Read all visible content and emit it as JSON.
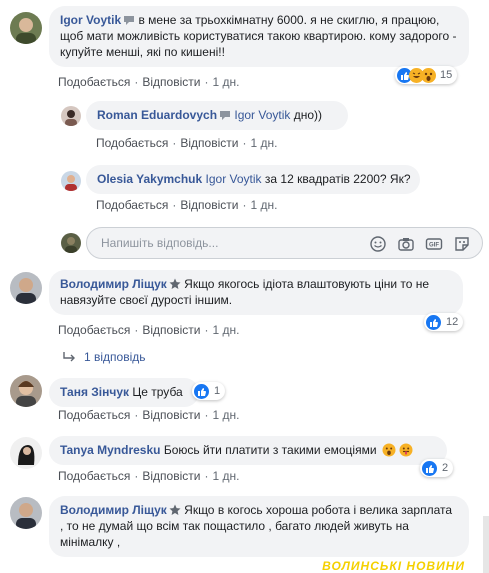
{
  "comments": [
    {
      "author": "Igor Voytik",
      "text": "в мене за трьохкімнатну 6000. я не скиглю, я працюю, щоб мати можливість користуватися такою квартирою. кому задорого - купуйте менші, які по кишені!!",
      "like": "Подобається",
      "reply": "Відповісти",
      "time": "1 дн.",
      "reaction_count": "15"
    },
    {
      "author": "Roman Eduardovych",
      "tag": "Igor Voytik",
      "text": "дно))",
      "like": "Подобається",
      "reply": "Відповісти",
      "time": "1 дн."
    },
    {
      "author": "Olesia Yakymchuk",
      "tag": "Igor Voytik",
      "text": "за 12 квадратів 2200? Як?",
      "like": "Подобається",
      "reply": "Відповісти",
      "time": "1 дн."
    },
    {
      "author": "Володимир Ліщук",
      "text": "Якщо якогось ідіота влаштовують ціни то не навязуйте своєї дурості іншим.",
      "like": "Подобається",
      "reply": "Відповісти",
      "time": "1 дн.",
      "reaction_count": "12",
      "replies_label": "1 відповідь"
    },
    {
      "author": "Таня Зінчук",
      "text": "Це труба",
      "like": "Подобається",
      "reply": "Відповісти",
      "time": "1 дн.",
      "reaction_count": "1"
    },
    {
      "author": "Tanya Myndresku",
      "text": "Боюсь йти платити з такими емоціями",
      "like": "Подобається",
      "reply": "Відповісти",
      "time": "1 дн.",
      "reaction_count": "2"
    },
    {
      "author": "Володимир Ліщук",
      "text": "Якщо в когось хороша робота і велика зарплата , то не думай що всім так пощастило , багато людей живуть на мінімалку ,"
    }
  ],
  "reply_box": {
    "placeholder": "Напишіть відповідь..."
  },
  "watermark": "ВОЛИНСЬКІ НОВИНИ",
  "colors": {
    "link": "#385898",
    "bubble": "#f2f3f5",
    "like_blue": "#1877f2",
    "emoji_yellow": "#f7b125"
  }
}
